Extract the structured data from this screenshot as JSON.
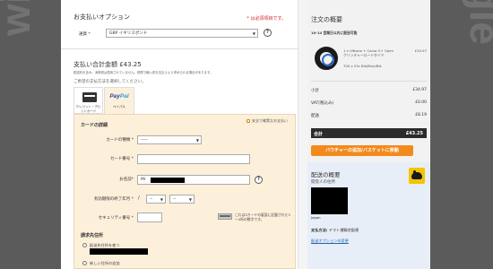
{
  "watermark": {
    "left": "wiggle",
    "right": "wiggle"
  },
  "payment_options": {
    "title": "お支払いオプション",
    "required_note": "* は必須項目です。",
    "currency_label": "通貨 *",
    "currency_value": "GBP イギリスポンド",
    "help": "?"
  },
  "payment": {
    "total_label": "支払い合計金額 £43.25",
    "note": "配送料を含み、消費税は適用されていません。税関で輸入税を支払うよう求められる場合があります。",
    "choose_method": "ご希望の支払方法を選択してください。",
    "tabs": [
      {
        "label": "クレジット・デビットカード"
      },
      {
        "logo_a": "Pay",
        "logo_b": "Pal",
        "label": "ペイパル"
      }
    ]
  },
  "card_form": {
    "heading": "カードの詳細",
    "secure_link": "安全で確実なお支払い",
    "card_type_label": "カードの種類 *",
    "card_type_value": "-----",
    "card_number_label": "カード番号 *",
    "name_label": "お名前*",
    "name_prefix": "Mr",
    "expiry_label": "有効期限の終了年月 *",
    "expiry_month": "--",
    "expiry_year": "--",
    "expiry_sep": "/",
    "security_label": "セキュリティ番号 *",
    "security_hint": "これは3カードの裏面に記載された3～4桁の数字です。",
    "billing_heading": "請求先住所",
    "billing_option1": "配送先住所を使う",
    "billing_option2": "新しい住所の追加"
  },
  "order_summary": {
    "title": "注文の概要",
    "shipping_notice": "10-14 営業日以内に配送可能",
    "product": {
      "name": "1 x Vittoria + Corsa G+ Open クリンチャーロードタイヤ",
      "price": "£34.97",
      "option": "700 x 25c Blk/Blue/Blk"
    },
    "rows": [
      {
        "label": "小計",
        "value": "£34.97"
      },
      {
        "label": "VAT(税込み)",
        "value": "£0.00"
      },
      {
        "label": "配送",
        "value": "£8.19"
      }
    ],
    "total_label": "合計",
    "total_value": "£43.25",
    "basket_button": "バウチャーの追加/バスケットに移動"
  },
  "delivery_summary": {
    "title": "配送の概要",
    "subtitle": "開受人の住所",
    "country": "Japan",
    "method_label": "支払方法:",
    "method_value": "ヤマト運輸宅配便",
    "change_link": "配送オプションの変更"
  },
  "colors": {
    "accent_orange": "#f28a1c",
    "required_red": "#d1232a",
    "form_bg": "#fdf0db",
    "delivery_bg": "#e7eef7",
    "total_bar": "#2b2b2b"
  }
}
